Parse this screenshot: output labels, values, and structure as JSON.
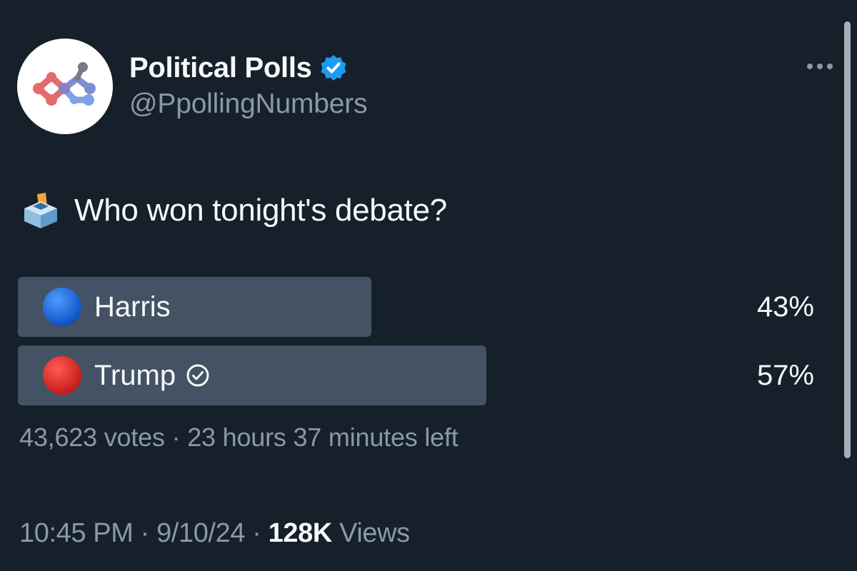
{
  "author": {
    "display_name": "Political Polls",
    "handle": "@PpollingNumbers",
    "verified": true
  },
  "tweet": {
    "question": "Who won tonight's debate?"
  },
  "poll": {
    "options": [
      {
        "label": "Harris",
        "percent": 43,
        "percent_label": "43%",
        "dot_color": "#1565e0",
        "winner": false
      },
      {
        "label": "Trump",
        "percent": 57,
        "percent_label": "57%",
        "dot_color": "#e02b2b",
        "winner": true
      }
    ],
    "votes": "43,623 votes",
    "separator": "·",
    "time_left": "23 hours 37 minutes left"
  },
  "meta": {
    "time": "10:45 PM",
    "date": "9/10/24",
    "views_count": "128K",
    "views_label": "Views",
    "separator": "·"
  },
  "colors": {
    "background": "#15202b",
    "poll_bar": "#435363",
    "verified_badge": "#1d9bf0",
    "muted_text": "#8b98a5"
  },
  "icons": {
    "avatar": "political-polls-logo-icon",
    "verified": "verified-badge-icon",
    "more": "more-options-icon",
    "ballot": "ballot-box-icon",
    "winner": "check-circle-icon"
  }
}
